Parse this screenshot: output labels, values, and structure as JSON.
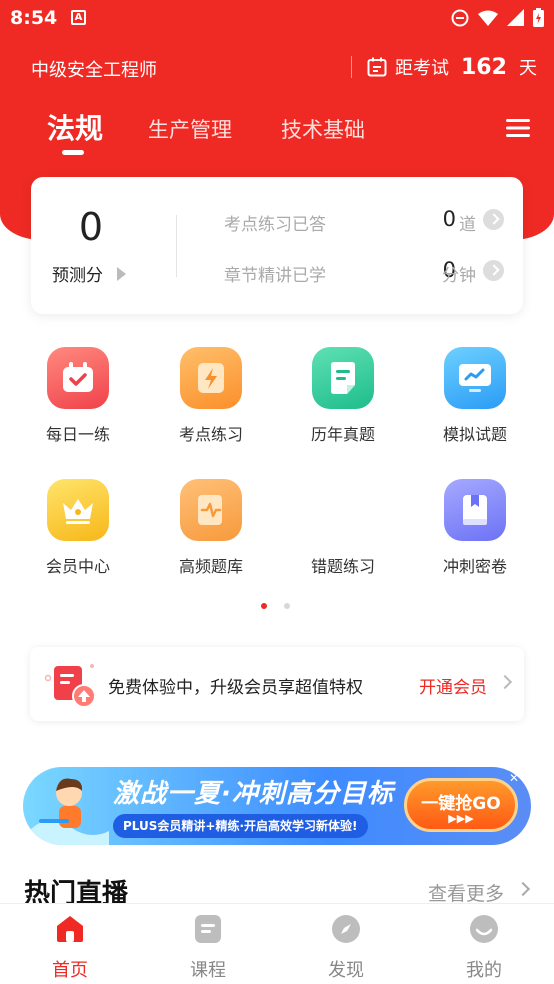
{
  "status_bar": {
    "time": "8:54",
    "notif_icon": "A"
  },
  "header": {
    "app_title": "中级安全工程师",
    "countdown_label": "距考试",
    "countdown_days": "162",
    "countdown_unit": "天"
  },
  "tabs": [
    {
      "label": "法规",
      "active": true
    },
    {
      "label": "生产管理",
      "active": false
    },
    {
      "label": "技术基础",
      "active": false
    }
  ],
  "stats": {
    "predicted_score": "0",
    "predicted_label": "预测分",
    "rows": [
      {
        "label": "考点练习已答",
        "value": "0",
        "unit": "道"
      },
      {
        "label": "章节精讲已学",
        "value": "0",
        "unit": "分钟"
      }
    ]
  },
  "grid": [
    {
      "label": "每日一练",
      "icon": "calendar-check-icon"
    },
    {
      "label": "考点练习",
      "icon": "lightning-doc-icon"
    },
    {
      "label": "历年真题",
      "icon": "document-icon"
    },
    {
      "label": "模拟试题",
      "icon": "monitor-chart-icon"
    },
    {
      "label": "会员中心",
      "icon": "crown-icon"
    },
    {
      "label": "高频题库",
      "icon": "pulse-scroll-icon"
    },
    {
      "label": "错题练习",
      "icon": ""
    },
    {
      "label": "冲刺密卷",
      "icon": "book-icon"
    }
  ],
  "pager": {
    "pages": 2,
    "current": 1
  },
  "member_promo": {
    "text": "免费体验中，升级会员享超值特权",
    "link": "开通会员"
  },
  "banner": {
    "title": "激战一夏·冲刺高分目标",
    "subtitle": "PLUS会员精讲+精练·开启高效学习新体验!",
    "button": "一键抢GO"
  },
  "live_section": {
    "title": "热门直播",
    "more": "查看更多"
  },
  "bottom_nav": [
    {
      "label": "首页",
      "active": true
    },
    {
      "label": "课程",
      "active": false
    },
    {
      "label": "发现",
      "active": false
    },
    {
      "label": "我的",
      "active": false
    }
  ],
  "colors": {
    "brand_red": "#ef2a24"
  }
}
